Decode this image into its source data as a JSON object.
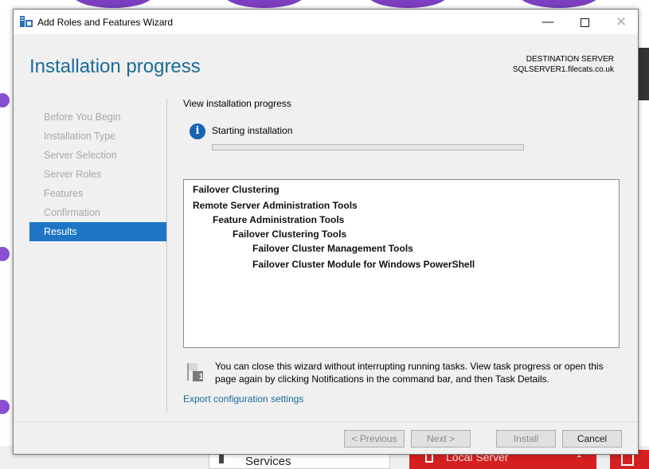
{
  "window": {
    "title": "Add Roles and Features Wizard",
    "minimize_glyph": "—",
    "close_glyph": "✕"
  },
  "header": {
    "page_title": "Installation progress",
    "destination_label": "DESTINATION SERVER",
    "destination_server": "SQLSERVER1.filecats.co.uk"
  },
  "nav": {
    "items": [
      {
        "label": "Before You Begin",
        "active": false
      },
      {
        "label": "Installation Type",
        "active": false
      },
      {
        "label": "Server Selection",
        "active": false
      },
      {
        "label": "Server Roles",
        "active": false
      },
      {
        "label": "Features",
        "active": false
      },
      {
        "label": "Confirmation",
        "active": false
      },
      {
        "label": "Results",
        "active": true
      }
    ]
  },
  "main": {
    "heading": "View installation progress",
    "status_text": "Starting installation",
    "progress_fraction": 0.0,
    "info_glyph": "i",
    "results": [
      {
        "label": "Failover Clustering",
        "level": 0
      },
      {
        "label": "Remote Server Administration Tools",
        "level": 0
      },
      {
        "label": "Feature Administration Tools",
        "level": 1
      },
      {
        "label": "Failover Clustering Tools",
        "level": 2
      },
      {
        "label": "Failover Cluster Management Tools",
        "level": 3
      },
      {
        "label": "Failover Cluster Module for Windows PowerShell",
        "level": 3
      }
    ],
    "note_text": "You can close this wizard without interrupting running tasks. View task progress or open this page again by clicking Notifications in the command bar, and then Task Details.",
    "note_badge": "1",
    "export_link": "Export configuration settings"
  },
  "footer": {
    "previous_label": "< Previous",
    "next_label": "Next >",
    "install_label": "Install",
    "cancel_label": "Cancel"
  },
  "background": {
    "services_label": "Services",
    "local_server_label": "Local Server",
    "local_server_count": "1",
    "colors": {
      "accent_red": "#d61f1f",
      "purple": "#7b3fbf"
    }
  },
  "colors": {
    "title_blue": "#1a6b99",
    "nav_active": "#1e75c6",
    "info_blue": "#1665b4",
    "progress_green": "#06b025"
  }
}
